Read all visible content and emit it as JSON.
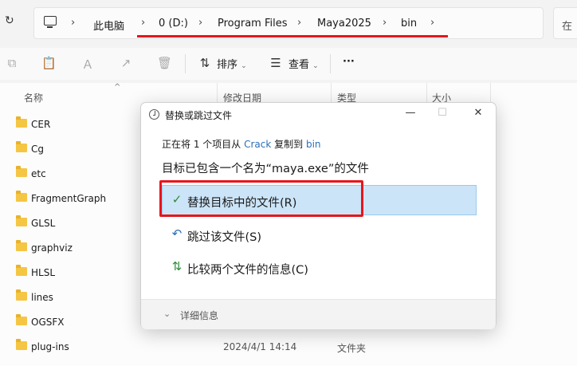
{
  "address_bar": {
    "crumbs": [
      "此电脑",
      "0 (D:)",
      "Program Files",
      "Maya2025",
      "bin"
    ],
    "search_text": "在"
  },
  "toolbar": {
    "sort_label": "排序",
    "view_label": "查看",
    "more_label": "···"
  },
  "file_list": {
    "columns": [
      "名称",
      "修改日期",
      "类型",
      "大小"
    ],
    "rows": [
      {
        "name": "CER",
        "date": "",
        "type": ""
      },
      {
        "name": "Cg",
        "date": "",
        "type": ""
      },
      {
        "name": "etc",
        "date": "",
        "type": ""
      },
      {
        "name": "FragmentGraph",
        "date": "",
        "type": ""
      },
      {
        "name": "GLSL",
        "date": "",
        "type": ""
      },
      {
        "name": "graphviz",
        "date": "",
        "type": ""
      },
      {
        "name": "HLSL",
        "date": "",
        "type": ""
      },
      {
        "name": "lines",
        "date": "",
        "type": ""
      },
      {
        "name": "OGSFX",
        "date": "",
        "type": ""
      },
      {
        "name": "plug-ins",
        "date": "2024/4/1 14:14",
        "type": "文件夹"
      }
    ]
  },
  "dialog": {
    "title": "替换或跳过文件",
    "progress": {
      "prefix": "正在将 1 个项目从 ",
      "source": "Crack",
      "middle": " 复制到 ",
      "dest": "bin"
    },
    "heading": "目标已包含一个名为“maya.exe”的文件",
    "options": [
      {
        "label": "替换目标中的文件(R)",
        "icon": "check-icon"
      },
      {
        "label": "跳过该文件(S)",
        "icon": "skip-arrow-icon"
      },
      {
        "label": "比较两个文件的信息(C)",
        "icon": "compare-icon"
      }
    ],
    "details_label": "详细信息"
  },
  "colors": {
    "accent": "#2a6fb8",
    "selected_bg": "#cce4f7",
    "highlight_red": "#e8141b",
    "folder": "#f5c644",
    "check_green": "#2e8b3a"
  }
}
